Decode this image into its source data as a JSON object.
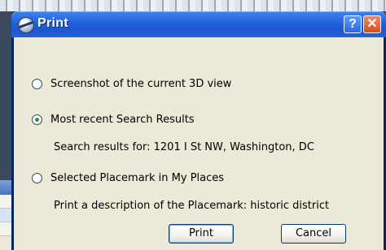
{
  "dialog": {
    "title": "Print",
    "help_label": "?",
    "close_label": "✕"
  },
  "options": [
    {
      "label": "Screenshot of the current 3D view",
      "checked": false
    },
    {
      "label": "Most recent Search Results",
      "checked": true
    },
    {
      "label": "Selected Placemark in My Places",
      "checked": false
    }
  ],
  "info": {
    "search_results": "Search results for: 1201 I St NW, Washington, DC",
    "placemark": "Print a description of the Placemark: historic district"
  },
  "buttons": {
    "print": "Print",
    "cancel": "Cancel"
  },
  "colors": {
    "titlebar": "#2362d9",
    "dialog_bg": "#ece9d8",
    "radio_selected": "#21a121",
    "close_button": "#d74b1e"
  }
}
